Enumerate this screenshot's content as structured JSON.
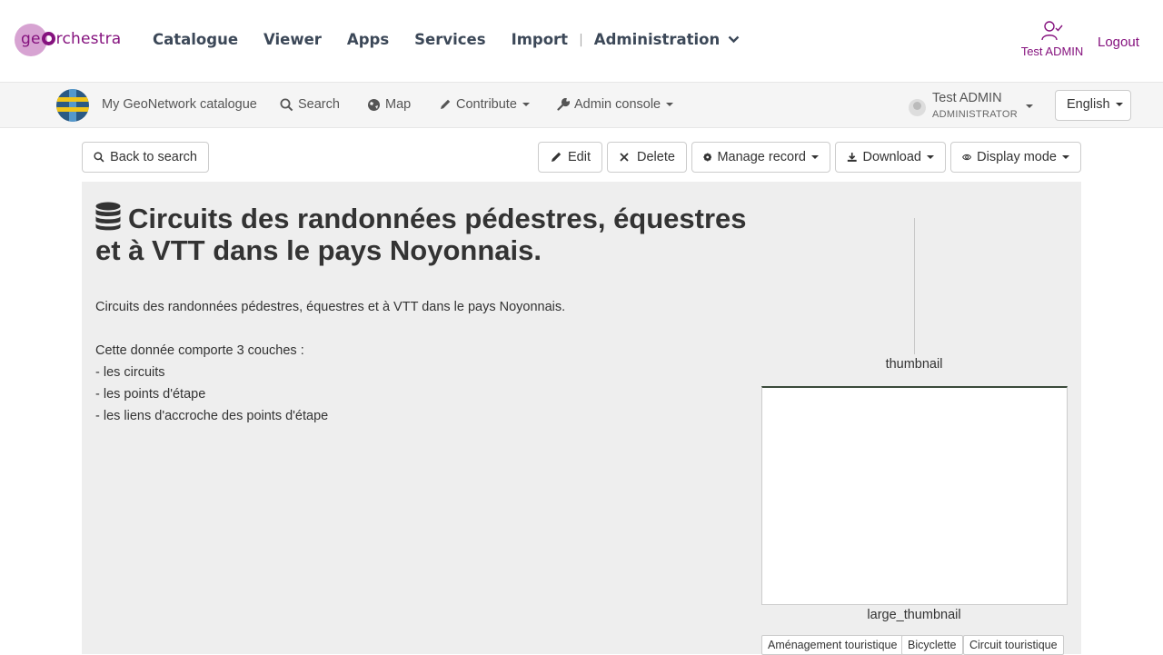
{
  "geo_header": {
    "logo": {
      "prefix": "ge",
      "suffix": "rchestra"
    },
    "nav": [
      "Catalogue",
      "Viewer",
      "Apps",
      "Services",
      "Import"
    ],
    "separator": "|",
    "admin_label": "Administration",
    "user_label": "Test ADMIN",
    "logout_label": "Logout",
    "accent_color": "#85127e"
  },
  "gn_bar": {
    "catalog_name": "My GeoNetwork catalogue",
    "search_label": "Search",
    "map_label": "Map",
    "contribute_label": "Contribute",
    "admin_console_label": "Admin console",
    "user_name": "Test ADMIN",
    "user_role": "ADMINISTRATOR",
    "language": "English"
  },
  "toolbar": {
    "back_label": "Back to search",
    "edit_label": "Edit",
    "delete_label": "Delete",
    "manage_label": "Manage record",
    "download_label": "Download",
    "display_label": "Display mode"
  },
  "record": {
    "title": "Circuits des randonnées pédestres, équestres et à VTT dans le pays Noyonnais.",
    "abstract": [
      "Circuits des randonnées pédestres, équestres et à VTT dans le pays Noyonnais.",
      "",
      "Cette donnée comporte 3 couches :",
      "- les circuits",
      "- les points d'étape",
      "- les liens d'accroche des points d'étape"
    ],
    "thumbnail_caption": "thumbnail",
    "large_thumbnail_caption": "large_thumbnail",
    "tags": [
      "Aménagement touristique",
      "Bicyclette",
      "Circuit touristique"
    ]
  }
}
